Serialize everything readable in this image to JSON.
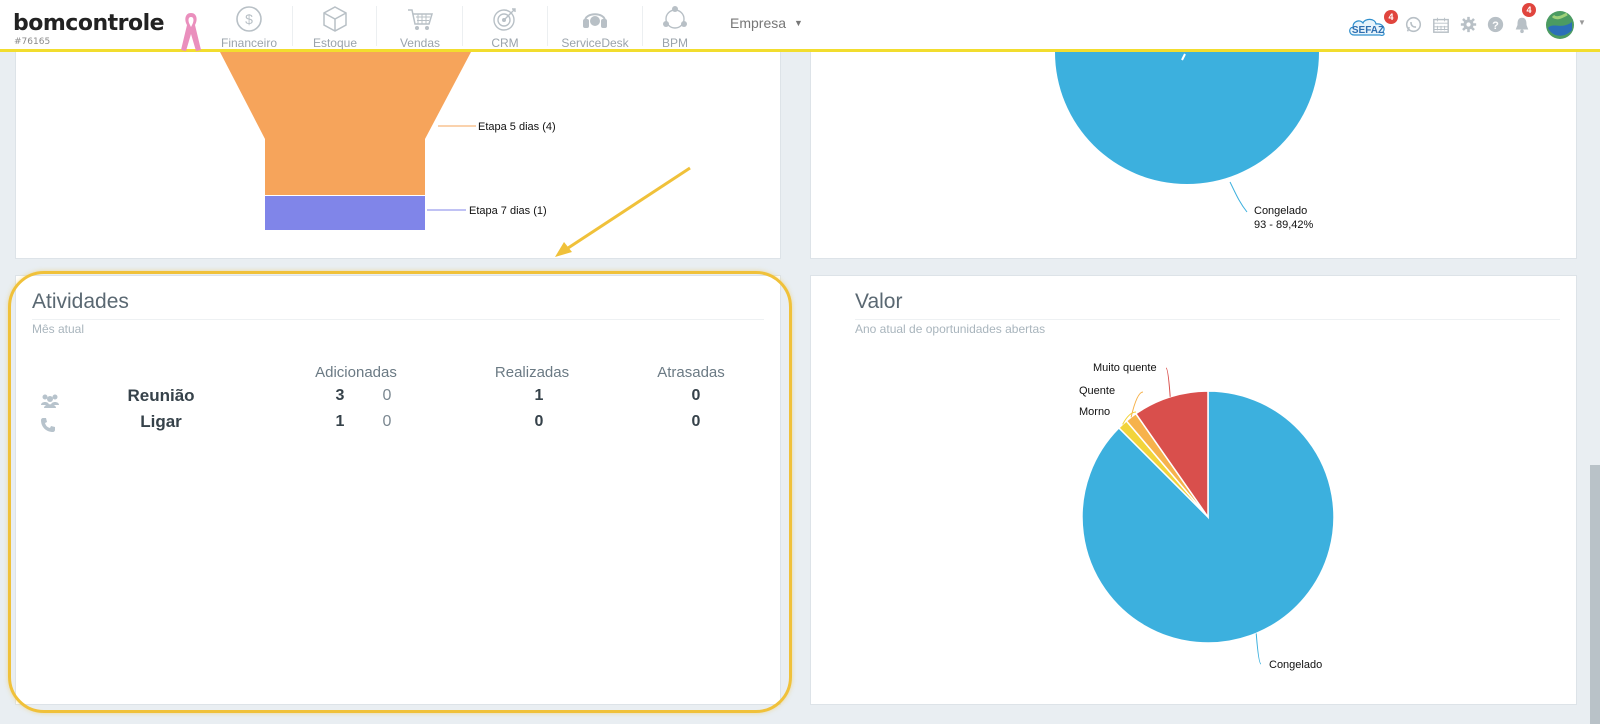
{
  "brand": {
    "name": "bomcontrole",
    "account_id": "#76165"
  },
  "nav": {
    "items": [
      {
        "label": "Financeiro",
        "icon": "dollar-circle-icon"
      },
      {
        "label": "Estoque",
        "icon": "box-icon"
      },
      {
        "label": "Vendas",
        "icon": "shopping-cart-icon"
      },
      {
        "label": "CRM",
        "icon": "target-icon"
      },
      {
        "label": "ServiceDesk",
        "icon": "headset-icon"
      },
      {
        "label": "BPM",
        "icon": "network-icon"
      }
    ],
    "empresa_label": "Empresa"
  },
  "toolbar": {
    "sefaz_label": "SEFAZ",
    "sefaz_badge": "4",
    "notifications_badge": "4"
  },
  "funnel_panel": {
    "labels": {
      "stage5": "Etapa 5 dias (4)",
      "stage7": "Etapa 7 dias (1)"
    },
    "colors": {
      "stage5": "#f6a45b",
      "stage7": "#8085e9"
    }
  },
  "top_right_panel": {
    "label_name": "Congelado",
    "label_value": "93 - 89,42%",
    "color": "#3cb0de"
  },
  "activities": {
    "title": "Atividades",
    "subtitle": "Mês atual",
    "columns": [
      "Adicionadas",
      "Realizadas",
      "Atrasadas"
    ],
    "rows": [
      {
        "name": "Reunião",
        "icon": "users-icon",
        "added": "3",
        "added_extra": "0",
        "done": "1",
        "late": "0"
      },
      {
        "name": "Ligar",
        "icon": "phone-icon",
        "added": "1",
        "added_extra": "0",
        "done": "0",
        "late": "0"
      }
    ]
  },
  "valor": {
    "title": "Valor",
    "subtitle": "Ano atual de oportunidades abertas"
  },
  "chart_data": {
    "type": "pie",
    "title": "Valor",
    "subtitle": "Ano atual de oportunidades abertas",
    "slices": [
      {
        "name": "Congelado",
        "value": 87.5,
        "color": "#3cb0de"
      },
      {
        "name": "Morno",
        "value": 1.3,
        "color": "#f2d43b"
      },
      {
        "name": "Quente",
        "value": 1.5,
        "color": "#f6b24c"
      },
      {
        "name": "Muito quente",
        "value": 9.7,
        "color": "#d94f4c"
      }
    ]
  }
}
